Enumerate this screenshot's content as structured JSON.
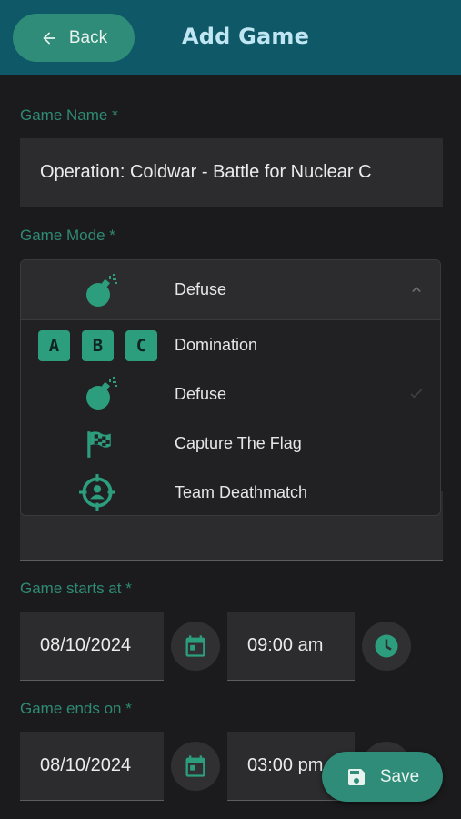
{
  "header": {
    "back_label": "Back",
    "title": "Add Game"
  },
  "form": {
    "name_label": "Game Name *",
    "name_value": "Operation: Coldwar - Battle for Nuclear C",
    "mode_label": "Game Mode *",
    "mode_selected": "Defuse",
    "mode_options": [
      "Domination",
      "Defuse",
      "Capture The Flag",
      "Team Deathmatch"
    ],
    "domination_letters": [
      "A",
      "B",
      "C"
    ],
    "start_label": "Game starts at *",
    "start_date": "08/10/2024",
    "start_time": "09:00 am",
    "end_label": "Game ends on *",
    "end_date": "08/10/2024",
    "end_time": "03:00 pm"
  },
  "actions": {
    "save_label": "Save"
  },
  "icons": [
    "back-arrow-icon",
    "bomb-icon",
    "chevron-up-icon",
    "check-icon",
    "flag-icon",
    "crosshair-icon",
    "calendar-icon",
    "clock-icon",
    "save-icon"
  ],
  "colors": {
    "header": "#0f5868",
    "accent": "#2e8c78",
    "label": "#2f8a73",
    "title": "#bfe6f2"
  }
}
